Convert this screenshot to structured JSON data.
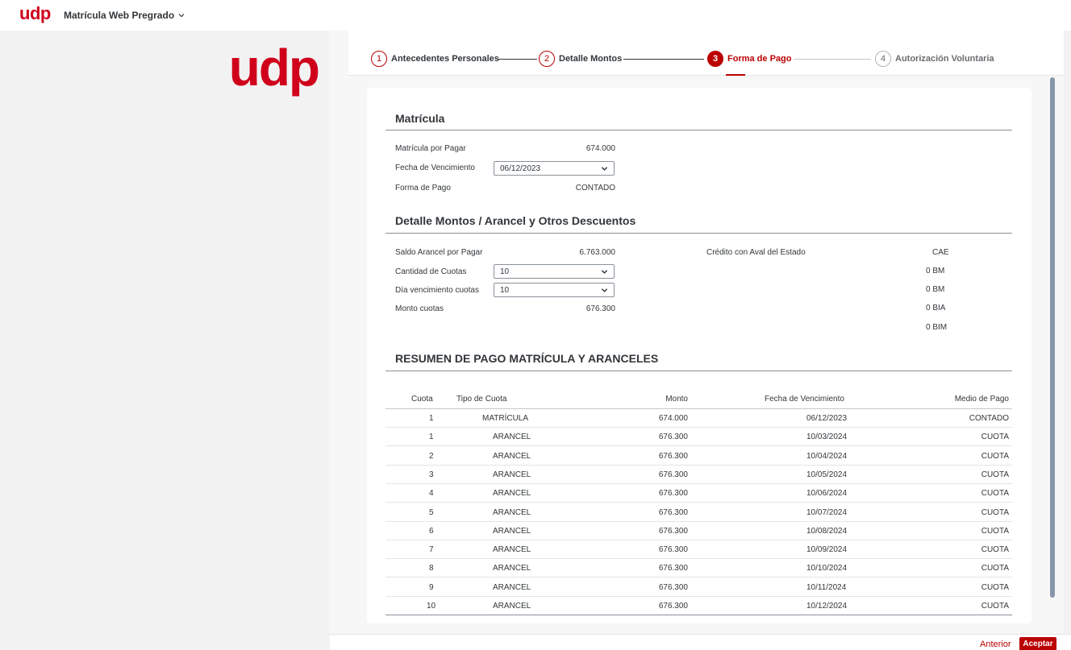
{
  "app": {
    "logo": "udp",
    "title": "Matrícula Web Pregrado"
  },
  "steps": [
    {
      "num": "1",
      "label": "Antecedentes Personales"
    },
    {
      "num": "2",
      "label": "Detalle Montos"
    },
    {
      "num": "3",
      "label": "Forma de Pago"
    },
    {
      "num": "4",
      "label": "Autorización Voluntaria"
    }
  ],
  "matricula": {
    "title": "Matrícula",
    "por_pagar_label": "Matrícula por Pagar",
    "por_pagar_value": "674.000",
    "fecha_label": "Fecha de Vencimiento",
    "fecha_value": "06/12/2023",
    "forma_label": "Forma de Pago",
    "forma_value": "CONTADO"
  },
  "detalle": {
    "title": "Detalle Montos / Arancel y Otros Descuentos",
    "saldo_label": "Saldo Arancel por Pagar",
    "saldo_value": "6.763.000",
    "cuotas_label": "Cantidad de Cuotas",
    "cuotas_value": "10",
    "dia_label": "Día vencimiento cuotas",
    "dia_value": "10",
    "monto_label": "Monto cuotas",
    "monto_value": "676.300",
    "cae_label": "Crédito con Aval del Estado",
    "cae_value": "CAE",
    "benefits": [
      "0  BM",
      "0  BM",
      "0  BIA",
      "0  BIM"
    ]
  },
  "resumen": {
    "title": "RESUMEN DE PAGO MATRÍCULA Y ARANCELES",
    "headers": [
      "Cuota",
      "Tipo de Cuota",
      "Monto",
      "Fecha de Vencimiento",
      "Medio de Pago"
    ],
    "rows": [
      [
        "1",
        "MATRÍCULA",
        "674.000",
        "06/12/2023",
        "CONTADO"
      ],
      [
        "1",
        "ARANCEL",
        "676.300",
        "10/03/2024",
        "CUOTA"
      ],
      [
        "2",
        "ARANCEL",
        "676.300",
        "10/04/2024",
        "CUOTA"
      ],
      [
        "3",
        "ARANCEL",
        "676.300",
        "10/05/2024",
        "CUOTA"
      ],
      [
        "4",
        "ARANCEL",
        "676.300",
        "10/06/2024",
        "CUOTA"
      ],
      [
        "5",
        "ARANCEL",
        "676.300",
        "10/07/2024",
        "CUOTA"
      ],
      [
        "6",
        "ARANCEL",
        "676.300",
        "10/08/2024",
        "CUOTA"
      ],
      [
        "7",
        "ARANCEL",
        "676.300",
        "10/09/2024",
        "CUOTA"
      ],
      [
        "8",
        "ARANCEL",
        "676.300",
        "10/10/2024",
        "CUOTA"
      ],
      [
        "9",
        "ARANCEL",
        "676.300",
        "10/11/2024",
        "CUOTA"
      ],
      [
        "10",
        "ARANCEL",
        "676.300",
        "10/12/2024",
        "CUOTA"
      ]
    ]
  },
  "footer": {
    "anterior": "Anterior",
    "aceptar": "Aceptar"
  },
  "colors": {
    "brand": "#d0021b",
    "accent": "#bb0000"
  },
  "icons": {
    "dropdown": "chevron-down-icon",
    "title_menu": "chevron-down-icon"
  }
}
